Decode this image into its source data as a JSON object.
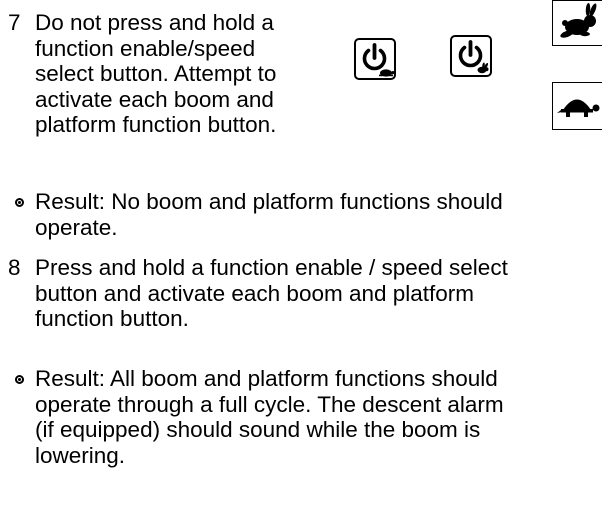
{
  "steps": [
    {
      "number": "7",
      "lines": [
        "Do not press and hold a",
        "function enable/speed",
        "select button. Attempt to",
        "activate each boom and",
        "platform function button."
      ]
    },
    {
      "number": "8",
      "lines": [
        "Press and hold a function enable / speed select",
        "button and activate each boom and platform",
        "function button."
      ]
    }
  ],
  "results": [
    {
      "lines": [
        "Result: No boom and platform functions should",
        "operate."
      ]
    },
    {
      "lines": [
        "Result: All boom and platform functions should",
        "operate through a full cycle. The descent alarm",
        "(if equipped) should sound while the boom is",
        "lowering."
      ]
    }
  ],
  "icons": {
    "button_slow": "power-turtle-icon",
    "button_fast": "power-rabbit-icon",
    "edge_top": "rabbit-icon",
    "edge_bottom": "turtle-icon"
  }
}
